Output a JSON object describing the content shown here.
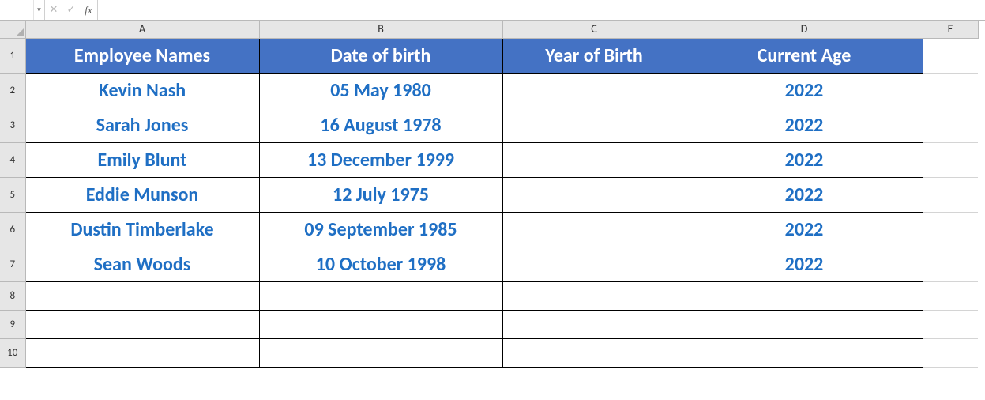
{
  "formula_bar": {
    "name_box": "",
    "fx_label": "fx",
    "formula": ""
  },
  "columns": [
    "A",
    "B",
    "C",
    "D",
    "E"
  ],
  "rows": [
    "1",
    "2",
    "3",
    "4",
    "5",
    "6",
    "7",
    "8",
    "9",
    "10"
  ],
  "headers": {
    "A": "Employee Names",
    "B": "Date of birth",
    "C": "Year of Birth",
    "D": "Current Age"
  },
  "data": [
    {
      "name": "Kevin Nash",
      "dob": "05 May 1980",
      "yob": "",
      "age": "2022"
    },
    {
      "name": "Sarah Jones",
      "dob": "16 August 1978",
      "yob": "",
      "age": "2022"
    },
    {
      "name": "Emily Blunt",
      "dob": "13 December 1999",
      "yob": "",
      "age": "2022"
    },
    {
      "name": "Eddie Munson",
      "dob": "12 July 1975",
      "yob": "",
      "age": "2022"
    },
    {
      "name": "Dustin Timberlake",
      "dob": "09 September 1985",
      "yob": "",
      "age": "2022"
    },
    {
      "name": "Sean Woods",
      "dob": "10 October 1998",
      "yob": "",
      "age": "2022"
    }
  ]
}
